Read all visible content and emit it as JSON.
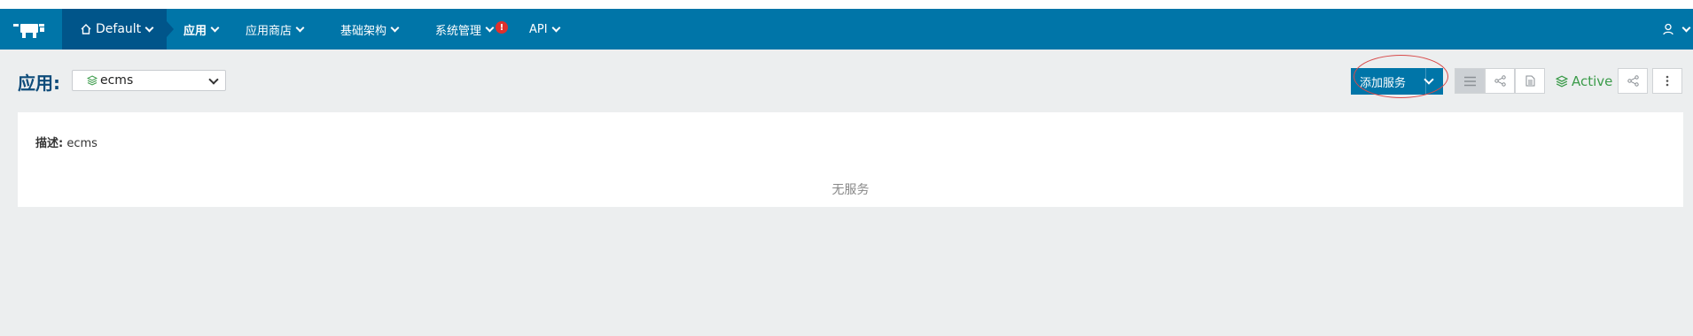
{
  "navbar": {
    "environment_label": "Default",
    "items": [
      {
        "label": "应用"
      },
      {
        "label": "应用商店"
      },
      {
        "label": "基础架构"
      },
      {
        "label": "系统管理"
      },
      {
        "label": "API"
      }
    ],
    "system_warning_badge": "!"
  },
  "page": {
    "title": "应用:",
    "app_select_value": "ecms"
  },
  "toolbar": {
    "add_service_label": "添加服务",
    "status_label": "Active"
  },
  "panel": {
    "description_label": "描述:",
    "description_value": "ecms",
    "empty_text": "无服务"
  },
  "colors": {
    "navbar": "#0075a8",
    "environment_tab": "#00558a",
    "accent": "#0075a8",
    "status_active": "#3b9b4a",
    "highlight_annotation": "#d84a4a"
  },
  "icons": [
    "rancher-logo",
    "home-icon",
    "chevron-down-icon",
    "warning-badge",
    "user-icon",
    "stack-icon",
    "list-view-icon",
    "graph-view-icon",
    "document-icon",
    "share-icon",
    "more-vertical-icon"
  ]
}
